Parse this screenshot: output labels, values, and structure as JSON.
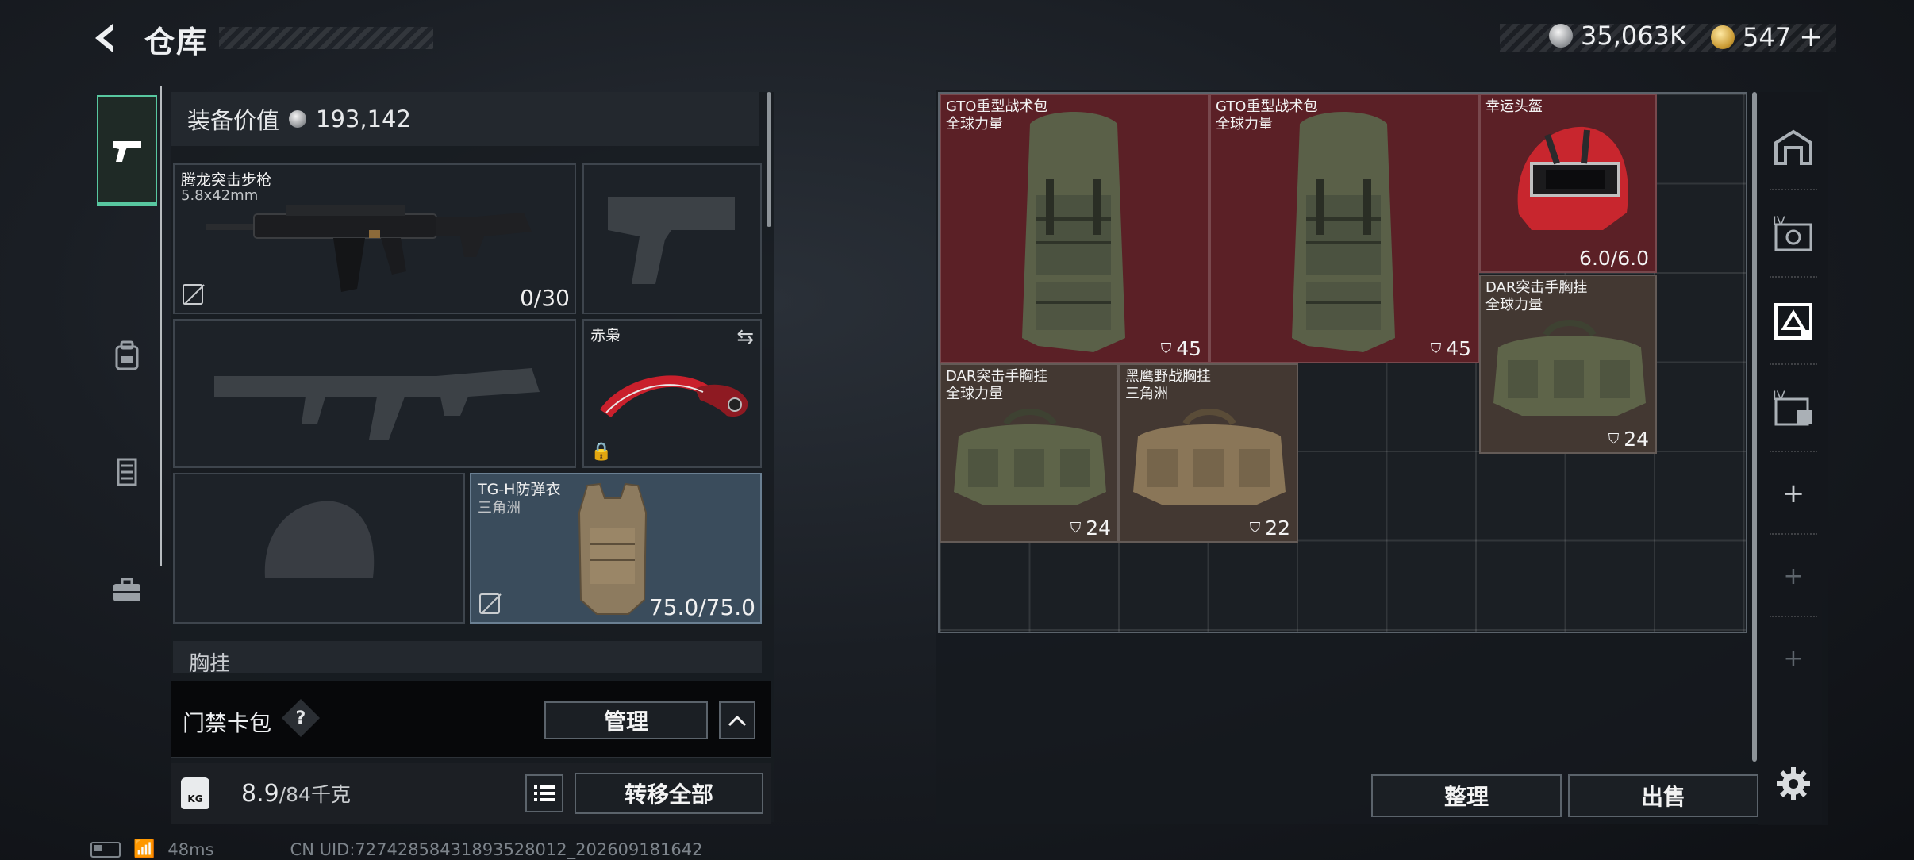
{
  "header": {
    "title": "仓库"
  },
  "currency": {
    "silver": "35,063K",
    "gold": "547"
  },
  "equip_value": {
    "label": "装备价值",
    "value": "193,142"
  },
  "slots": {
    "rifle": {
      "name": "腾龙突击步枪",
      "caliber": "5.8x42mm",
      "ammo": "0/30"
    },
    "melee": {
      "name": "赤枭"
    },
    "armor": {
      "name": "TG-H防弹衣",
      "source": "三角洲",
      "durability": "75.0/75.0"
    },
    "chest_section": "胸挂"
  },
  "keycard": {
    "label": "门禁卡包",
    "help": "?",
    "manage": "管理"
  },
  "bottom": {
    "weight": "8.9",
    "weight_max": "/84千克",
    "transfer_all": "转移全部"
  },
  "stash_items": [
    {
      "name": "GTO重型战术包",
      "source": "全球力量",
      "count": "45"
    },
    {
      "name": "GTO重型战术包",
      "source": "全球力量",
      "count": "45"
    },
    {
      "name": "幸运头盔",
      "source": "",
      "count": "6.0/6.0"
    },
    {
      "name": "DAR突击手胸挂",
      "source": "全球力量",
      "count": "24"
    },
    {
      "name": "DAR突击手胸挂",
      "source": "全球力量",
      "count": "24"
    },
    {
      "name": "黑鹰野战胸挂",
      "source": "三角洲",
      "count": "22"
    }
  ],
  "actions": {
    "sort": "整理",
    "sell": "出售"
  },
  "right_tabs": [
    "IV",
    "IV"
  ],
  "status": {
    "ping": "48ms",
    "uid": "CN UID:72742858431893528012_202609181642"
  },
  "colors": {
    "accent": "#58c7a0",
    "rare_red": "#5b2026",
    "item_brown": "#433832"
  }
}
